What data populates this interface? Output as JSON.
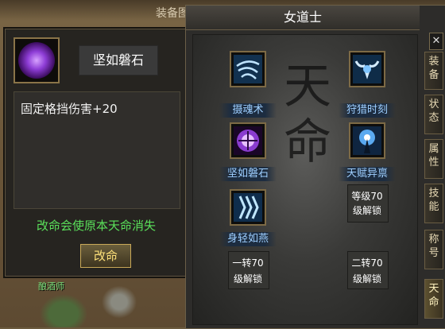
{
  "scene": {
    "title": "装备图签",
    "npc_label": "酿酒师"
  },
  "tooltip": {
    "skill_icon": "purple-orb-icon",
    "skill_name": "坚如磐石",
    "description": "固定格挡伤害+20",
    "warning": "改命会使原本天命消失",
    "change_button": "改命"
  },
  "panel": {
    "title": "女道士",
    "close_symbol": "✕",
    "calligraphy": "天命",
    "tabs": [
      {
        "label": "装备",
        "active": false
      },
      {
        "label": "状态",
        "active": false
      },
      {
        "label": "属性",
        "active": false
      },
      {
        "label": "技能",
        "active": false
      },
      {
        "label": "称号",
        "active": false
      },
      {
        "label": "天命",
        "active": true
      }
    ],
    "skills": [
      {
        "name": "摄魂术",
        "icon": "spirit-icon",
        "color": "#3c8fd8"
      },
      {
        "name": "狩猎时刻",
        "icon": "bull-head-icon",
        "color": "#2f7fc4"
      },
      {
        "name": "坚如磐石",
        "icon": "purple-orb-icon",
        "color": "#9b45d9"
      },
      {
        "name": "天赋异禀",
        "icon": "spark-figure-icon",
        "color": "#4a8fe0"
      },
      {
        "name": "身轻如燕",
        "icon": "wind-icon",
        "color": "#3a9be8"
      }
    ],
    "locked": [
      {
        "line1": "等级70",
        "line2": "级解锁"
      },
      {
        "line1": "一转70",
        "line2": "级解锁"
      },
      {
        "line1": "二转70",
        "line2": "级解锁"
      }
    ]
  }
}
